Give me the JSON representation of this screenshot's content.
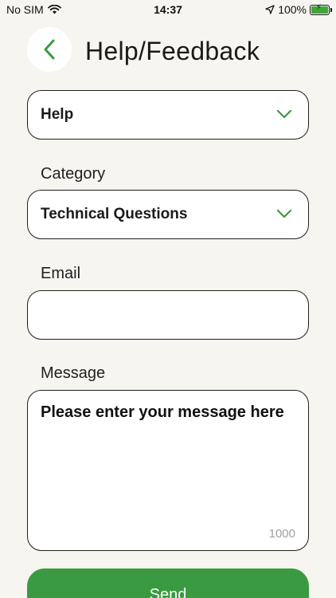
{
  "status_bar": {
    "carrier": "No SIM",
    "time": "14:37",
    "battery": "100%"
  },
  "header": {
    "title": "Help/Feedback"
  },
  "form": {
    "type_select": {
      "value": "Help"
    },
    "category": {
      "label": "Category",
      "value": "Technical Questions"
    },
    "email": {
      "label": "Email",
      "value": ""
    },
    "message": {
      "label": "Message",
      "placeholder": "Please enter your message here",
      "counter": "1000"
    },
    "send_label": "Send"
  },
  "colors": {
    "accent": "#3a9a41",
    "background": "#f6f5f0"
  }
}
